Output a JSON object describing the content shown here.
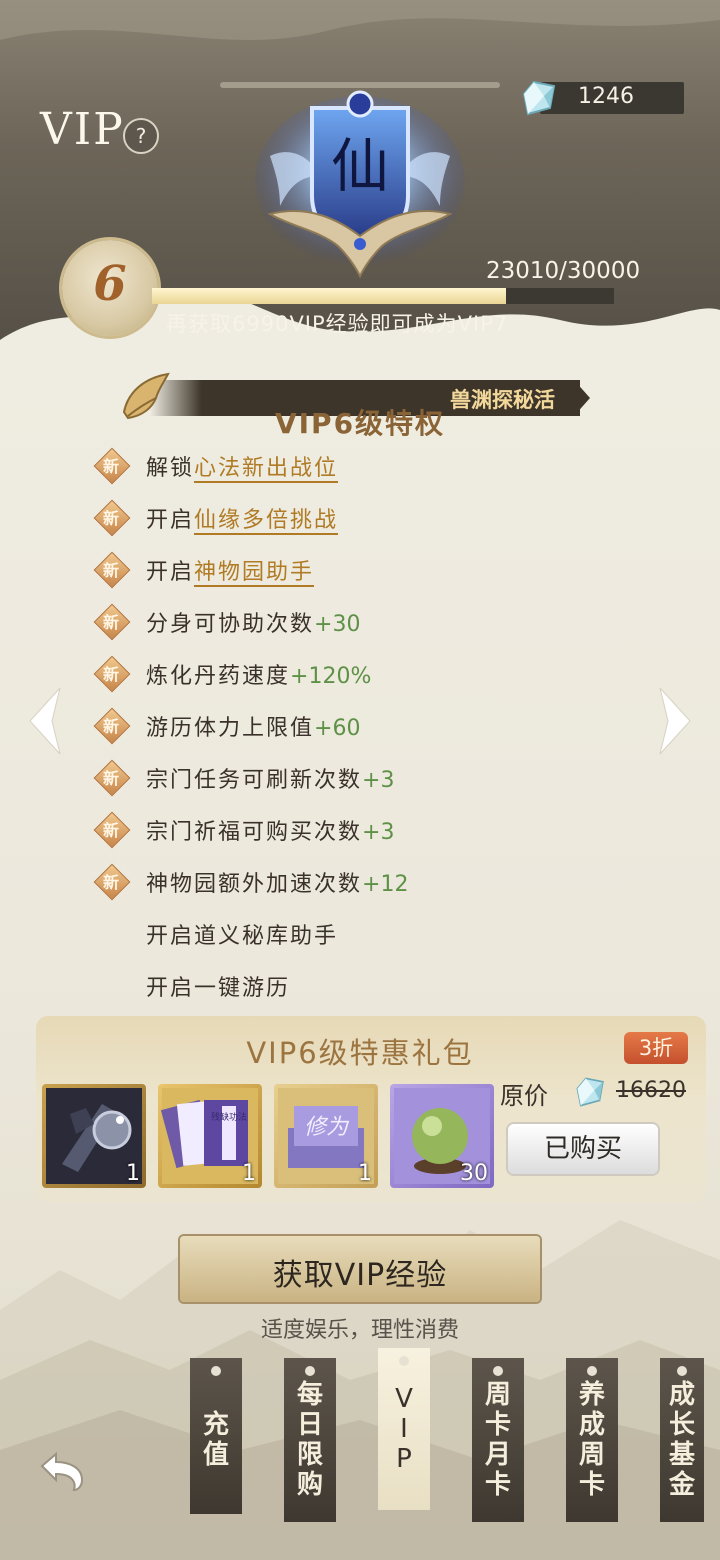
{
  "header": {
    "vip_title": "VIP",
    "help_icon_text": "?",
    "currency_count": "1246",
    "emblem_char": "仙"
  },
  "level": {
    "current": "6",
    "exp_text": "23010/30000",
    "exp_progress": 0.767,
    "hint": "再获取6990VIP经验即可成为VIP7"
  },
  "ribbon": {
    "text": "兽渊探秘活"
  },
  "privileges": {
    "title": "VIP6级特权",
    "items": [
      {
        "new_badge": "新",
        "prefix": "解锁",
        "highlight": "心法新出战位",
        "value": ""
      },
      {
        "new_badge": "新",
        "prefix": "开启",
        "highlight": "仙缘多倍挑战",
        "value": ""
      },
      {
        "new_badge": "新",
        "prefix": "开启",
        "highlight": "神物园助手",
        "value": ""
      },
      {
        "new_badge": "新",
        "prefix": "分身可协助次数",
        "highlight": "",
        "value": "+30"
      },
      {
        "new_badge": "新",
        "prefix": "炼化丹药速度",
        "highlight": "",
        "value": "+120%"
      },
      {
        "new_badge": "新",
        "prefix": "游历体力上限值",
        "highlight": "",
        "value": "+60"
      },
      {
        "new_badge": "新",
        "prefix": "宗门任务可刷新次数",
        "highlight": "",
        "value": "+3"
      },
      {
        "new_badge": "新",
        "prefix": "宗门祈福可购买次数",
        "highlight": "",
        "value": "+3"
      },
      {
        "new_badge": "新",
        "prefix": "神物园额外加速次数",
        "highlight": "",
        "value": "+12"
      },
      {
        "new_badge": "",
        "prefix": "开启道义秘库助手",
        "highlight": "",
        "value": ""
      },
      {
        "new_badge": "",
        "prefix": "开启一键游历",
        "highlight": "",
        "value": ""
      }
    ]
  },
  "gift": {
    "title": "VIP6级特惠礼包",
    "discount": "3折",
    "original_label": "原价",
    "original_price": "16620",
    "bought_label": "已购买",
    "items": [
      {
        "count": "1",
        "icon": "equipment-icon"
      },
      {
        "count": "1",
        "icon": "skill-book-icon"
      },
      {
        "count": "1",
        "icon": "scroll-icon",
        "label": "修为"
      },
      {
        "count": "30",
        "icon": "orb-icon"
      }
    ],
    "book_label": "残缺功法"
  },
  "actions": {
    "get_exp": "获取VIP经验",
    "tip": "适度娱乐，理性消费"
  },
  "tabs": [
    {
      "label": "充\n值"
    },
    {
      "label": "每\n日\n限\n购"
    },
    {
      "label": "V\nI\nP"
    },
    {
      "label": "周\n卡\n月\n卡"
    },
    {
      "label": "养\n成\n周\n卡"
    },
    {
      "label": "成\n长\n基\n金"
    }
  ],
  "colors": {
    "highlight": "#b07b24",
    "value_green": "#5e9147",
    "discount_red": "#d0603a",
    "ribbon_gold": "#f3d89b"
  }
}
